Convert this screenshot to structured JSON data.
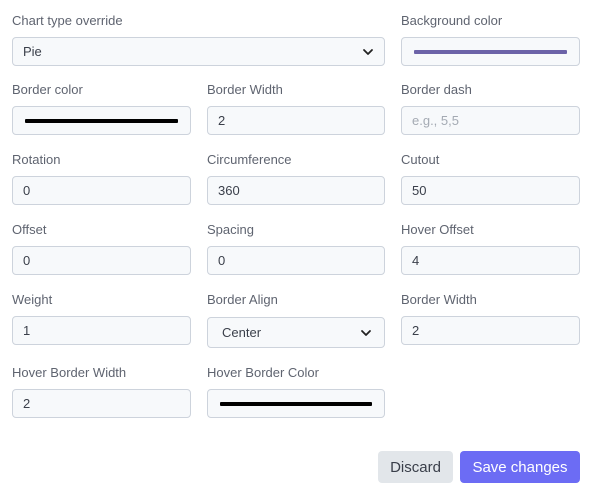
{
  "form": {
    "chart_type": {
      "label": "Chart type override",
      "value": "Pie"
    },
    "background_color": {
      "label": "Background color",
      "color": "#6c63a8"
    },
    "border_color": {
      "label": "Border color",
      "color": "#000000"
    },
    "border_width": {
      "label": "Border Width",
      "value": "2"
    },
    "border_dash": {
      "label": "Border dash",
      "placeholder": "e.g., 5,5"
    },
    "rotation": {
      "label": "Rotation",
      "value": "0"
    },
    "circumference": {
      "label": "Circumference",
      "value": "360"
    },
    "cutout": {
      "label": "Cutout",
      "value": "50"
    },
    "offset": {
      "label": "Offset",
      "value": "0"
    },
    "spacing": {
      "label": "Spacing",
      "value": "0"
    },
    "hover_offset": {
      "label": "Hover Offset",
      "value": "4"
    },
    "weight": {
      "label": "Weight",
      "value": "1"
    },
    "border_align": {
      "label": "Border Align",
      "value": "Center"
    },
    "border_width_2": {
      "label": "Border Width",
      "value": "2"
    },
    "hover_border_width": {
      "label": "Hover Border Width",
      "value": "2"
    },
    "hover_border_color": {
      "label": "Hover Border Color",
      "color": "#000000"
    }
  },
  "actions": {
    "discard_label": "Discard",
    "save_label": "Save changes"
  },
  "icons": {
    "select_arrow": "chevron-down-icon"
  }
}
